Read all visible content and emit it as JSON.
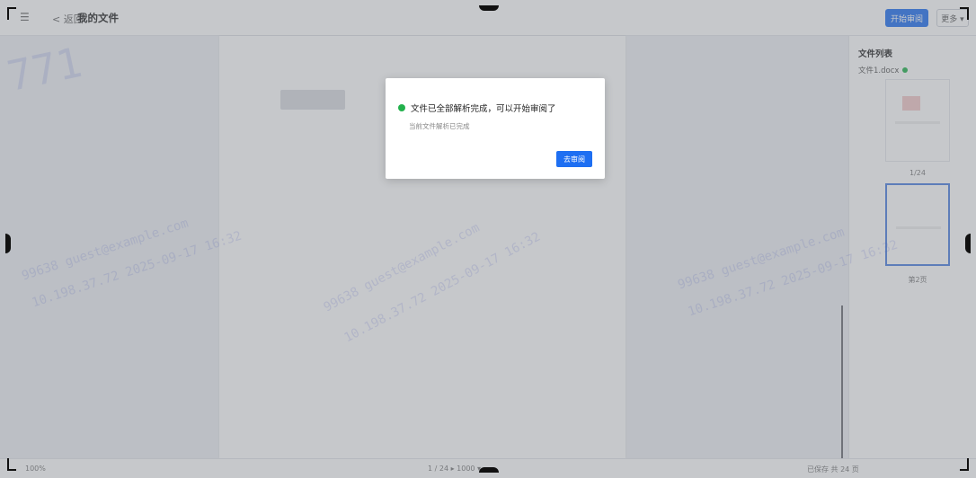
{
  "topbar": {
    "back_label": "< 返回",
    "doc_title": "我的文件",
    "primary_button": "开始审阅",
    "more_button": "更多 ▾"
  },
  "right_panel": {
    "title": "文件列表",
    "file_name": "文件1.docx",
    "thumb_labels": [
      "1/24",
      "第2页"
    ]
  },
  "bottombar": {
    "left": "100%",
    "center": "1 / 24    ▸    1000 ▾",
    "right": "已保存    共 24 页"
  },
  "watermarks": {
    "big": "771",
    "lines": [
      "99638 guest@example.com",
      "10.198.37.72 2025-09-17 16:32",
      "99638 guest@example.com",
      "10.198.37.72 2025-09-17 16:32",
      "99638 guest@example.com",
      "10.198.37.72 2025-09-17 16:32"
    ]
  },
  "modal": {
    "title": "文件已全部解析完成，可以开始审阅了",
    "description": "当前文件解析已完成",
    "button": "去审阅"
  },
  "colors": {
    "primary": "#1e6ff2",
    "success": "#22b14c",
    "watermark": "#3c50dc"
  }
}
